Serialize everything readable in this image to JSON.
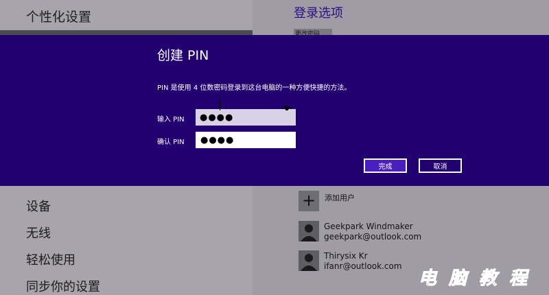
{
  "left": {
    "title": "个性化设置",
    "nav": [
      "设备",
      "无线",
      "轻松使用",
      "同步你的设置"
    ]
  },
  "right": {
    "title": "登录选项",
    "change_password": "更改密码",
    "add_user": "添加用户",
    "users": [
      {
        "name": "Geekpark Windmaker",
        "email": "geekpark@outlook.com"
      },
      {
        "name": "Thirysix Kr",
        "email": "ifanr@outlook.com"
      }
    ]
  },
  "dialog": {
    "title": "创建 PIN",
    "description": "PIN 是使用 4 位数密码登录到这台电脑的一种方便快捷的方法。",
    "enter_label": "输入 PIN",
    "confirm_label": "确认 PIN",
    "enter_value": "●●●●",
    "confirm_value": "●●●●",
    "ok_label": "完成",
    "cancel_label": "取消"
  },
  "icons": {
    "eye": "eye-icon",
    "add": "plus-icon",
    "avatar": "user-avatar-icon"
  },
  "colors": {
    "dialog_bg": "#23006f",
    "accent": "#4a1fc0",
    "title_accent": "#2c0d86"
  },
  "watermark": "电脑教程"
}
